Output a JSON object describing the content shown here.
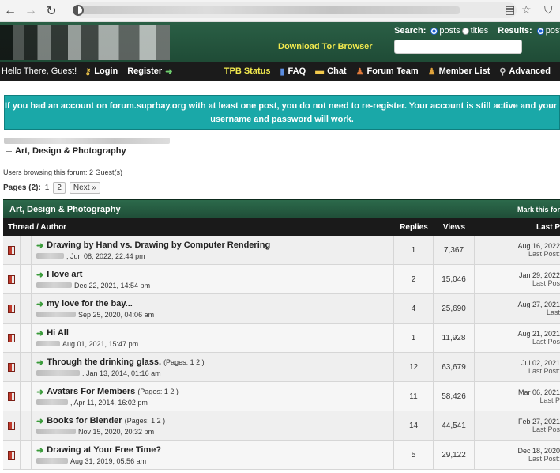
{
  "header": {
    "tor_link": "Download Tor Browser",
    "search_label": "Search:",
    "search_opt_posts": "posts",
    "search_opt_titles": "titles",
    "results_label": "Results:",
    "results_opt_posts": "posts"
  },
  "navbar": {
    "greeting": "Hello There, Guest!",
    "login": "Login",
    "register": "Register",
    "tpb_status": "TPB Status",
    "faq": "FAQ",
    "chat": "Chat",
    "forum_team": "Forum Team",
    "member_list": "Member List",
    "advanced": "Advanced"
  },
  "notice": {
    "line1": "If you had an account on forum.suprbay.org with at least one post, you do not need to re-register. Your account is still active and your S",
    "line2": "username and password will work."
  },
  "breadcrumb": {
    "current": "Art, Design & Photography"
  },
  "browsing": "Users browsing this forum: 2 Guest(s)",
  "pagination": {
    "label": "Pages (2):",
    "current": "1",
    "page2": "2",
    "next": "Next »"
  },
  "forum": {
    "title": "Art, Design & Photography",
    "mark_read": "Mark this for",
    "columns": {
      "thread": "Thread / Author",
      "replies": "Replies",
      "views": "Views",
      "last": "Last P"
    }
  },
  "threads": [
    {
      "title": "Drawing by Hand vs. Drawing by Computer Rendering",
      "pages": "",
      "date": ", Jun 08, 2022, 22:44 pm",
      "replies": "1",
      "views": "7,367",
      "last_date": "Aug 16, 2022",
      "last_post": "Last Post:"
    },
    {
      "title": "I love art",
      "pages": "",
      "date": "Dec 22, 2021, 14:54 pm",
      "replies": "2",
      "views": "15,046",
      "last_date": "Jan 29, 2022",
      "last_post": "Last Pos"
    },
    {
      "title": "my love for the bay...",
      "pages": "",
      "date": "Sep 25, 2020, 04:06 am",
      "replies": "4",
      "views": "25,690",
      "last_date": "Aug 27, 2021",
      "last_post": "Last"
    },
    {
      "title": "Hi All",
      "pages": "",
      "date": "Aug 01, 2021, 15:47 pm",
      "replies": "1",
      "views": "11,928",
      "last_date": "Aug 21, 2021",
      "last_post": "Last Pos"
    },
    {
      "title": "Through the drinking glass.",
      "pages": "(Pages: 1 2 )",
      "date": ". Jan 13, 2014, 01:16 am",
      "replies": "12",
      "views": "63,679",
      "last_date": "Jul 02, 2021",
      "last_post": "Last Post:"
    },
    {
      "title": "Avatars For Members",
      "pages": "(Pages: 1 2 )",
      "date": ", Apr 11, 2014, 16:02 pm",
      "replies": "11",
      "views": "58,426",
      "last_date": "Mar 06, 2021",
      "last_post": "Last P"
    },
    {
      "title": "Books for Blender",
      "pages": "(Pages: 1 2 )",
      "date": "Nov 15, 2020, 20:32 pm",
      "replies": "14",
      "views": "44,541",
      "last_date": "Feb 27, 2021",
      "last_post": "Last Pos"
    },
    {
      "title": "Drawing at Your Free Time?",
      "pages": "",
      "date": "Aug 31, 2019, 05:56 am",
      "replies": "5",
      "views": "29,122",
      "last_date": "Dec 18, 2020",
      "last_post": "Last Post:"
    }
  ]
}
